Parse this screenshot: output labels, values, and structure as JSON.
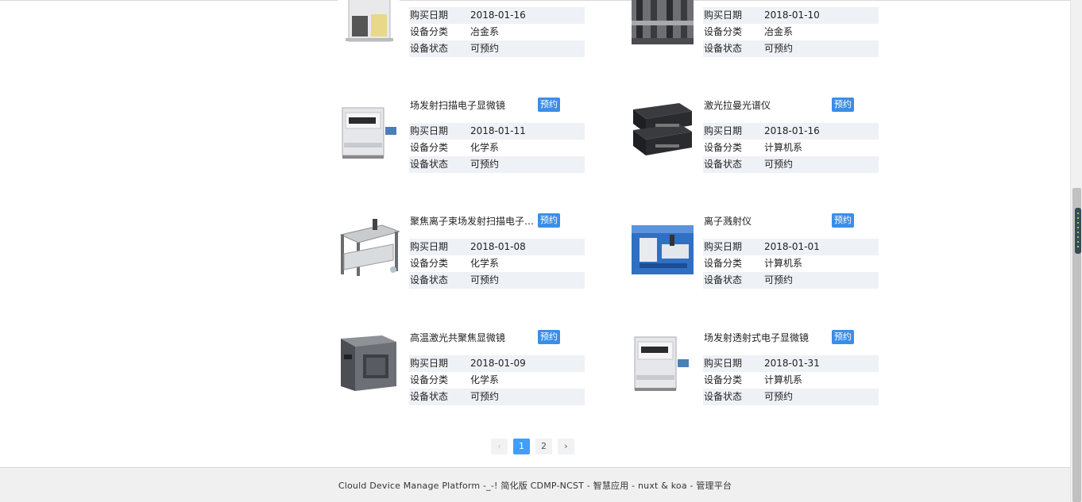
{
  "labels": {
    "purchase_date": "购买日期",
    "category": "设备分类",
    "status": "设备状态",
    "book": "预约"
  },
  "devices": [
    {
      "name": "",
      "purchase_date": "2018-01-16",
      "category": "冶金系",
      "status": "可预约",
      "image": "device-cabinet-icon"
    },
    {
      "name": "",
      "purchase_date": "2018-01-10",
      "category": "冶金系",
      "status": "可预约",
      "image": "device-rack-icon"
    },
    {
      "name": "场发射扫描电子显微镜",
      "purchase_date": "2018-01-11",
      "category": "化学系",
      "status": "可预约",
      "image": "device-machine-icon"
    },
    {
      "name": "激光拉曼光谱仪",
      "purchase_date": "2018-01-16",
      "category": "计算机系",
      "status": "可预约",
      "image": "device-black-box-icon"
    },
    {
      "name": "聚焦离子束场发射扫描电子显…",
      "purchase_date": "2018-01-08",
      "category": "化学系",
      "status": "可预约",
      "image": "device-table-icon"
    },
    {
      "name": "离子溅射仪",
      "purchase_date": "2018-01-01",
      "category": "计算机系",
      "status": "可预约",
      "image": "device-blue-machine-icon"
    },
    {
      "name": "高温激光共聚焦显微镜",
      "purchase_date": "2018-01-09",
      "category": "化学系",
      "status": "可预约",
      "image": "device-grey-box-icon"
    },
    {
      "name": "场发射透射式电子显微镜",
      "purchase_date": "2018-01-31",
      "category": "计算机系",
      "status": "可预约",
      "image": "device-machine-icon"
    }
  ],
  "pagination": {
    "prev": "‹",
    "pages": [
      "1",
      "2"
    ],
    "current": "1",
    "next": "›"
  },
  "footer": {
    "text": "Clould Device Manage Platform -_-! 简化版 CDMP-NCST - 智慧应用 - nuxt & koa - 管理平台"
  },
  "colors": {
    "accent": "#409eff",
    "book_button": "#3a8ee6",
    "row_shade": "#eef1f5"
  }
}
